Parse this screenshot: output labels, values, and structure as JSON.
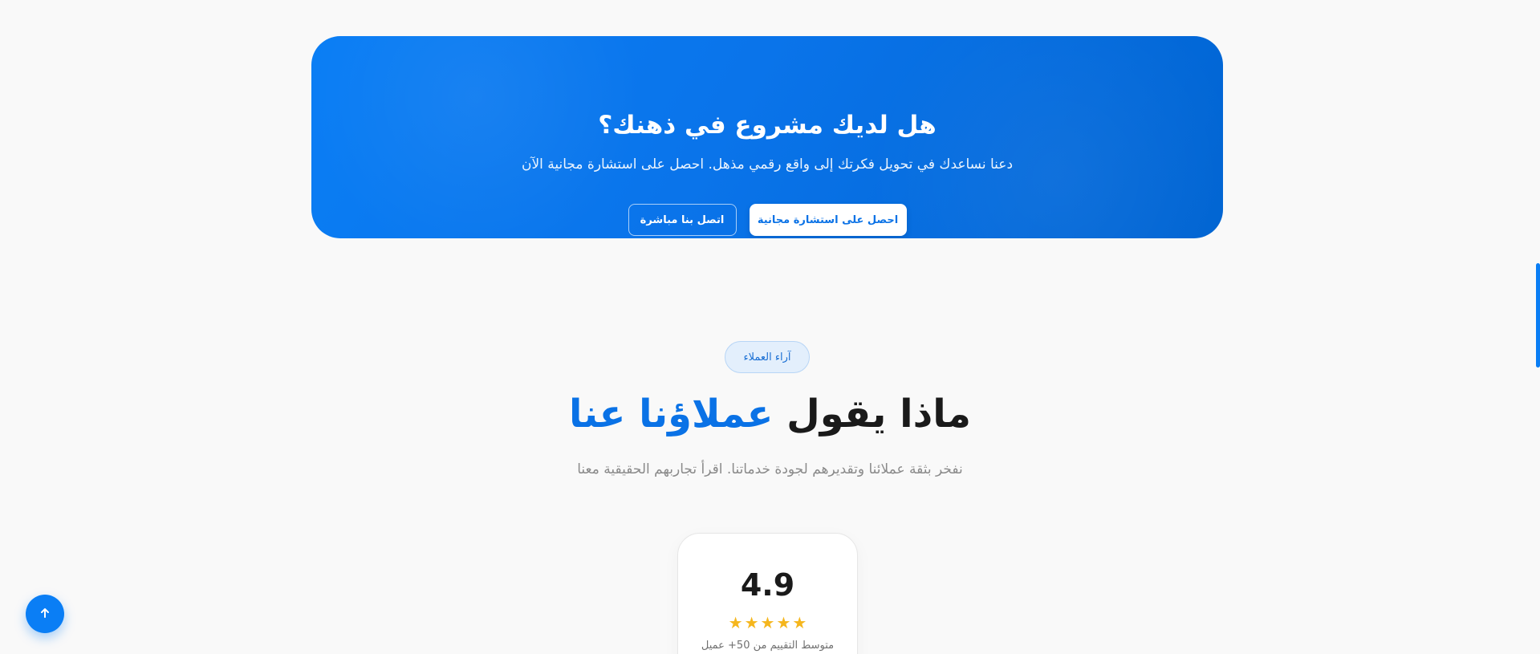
{
  "cta": {
    "title": "هل لديك مشروع في ذهنك؟",
    "subtitle": "دعنا نساعدك في تحويل فكرتك إلى واقع رقمي مذهل. احصل على استشارة مجانية الآن",
    "primary_button": "احصل على استشارة مجانية",
    "secondary_button": "اتصل بنا مباشرة"
  },
  "testimonials": {
    "badge": "آراء العملاء",
    "title_part1": "ماذا يقول",
    "title_accent": "عملاؤنا عنا",
    "subtitle": "نفخر بثقة عملائنا وتقديرهم لجودة خدماتنا. اقرأ تجاربهم الحقيقية معنا",
    "rating": {
      "value": "4.9",
      "stars": 5,
      "caption": "متوسط التقييم من 50+ عميل"
    }
  },
  "back_to_top": {
    "icon": "arrow-up-icon"
  },
  "colors": {
    "accent": "#0a7ef5",
    "accent_dark": "#0064d2",
    "star": "#f5b61d",
    "background": "#f9f9f9"
  }
}
